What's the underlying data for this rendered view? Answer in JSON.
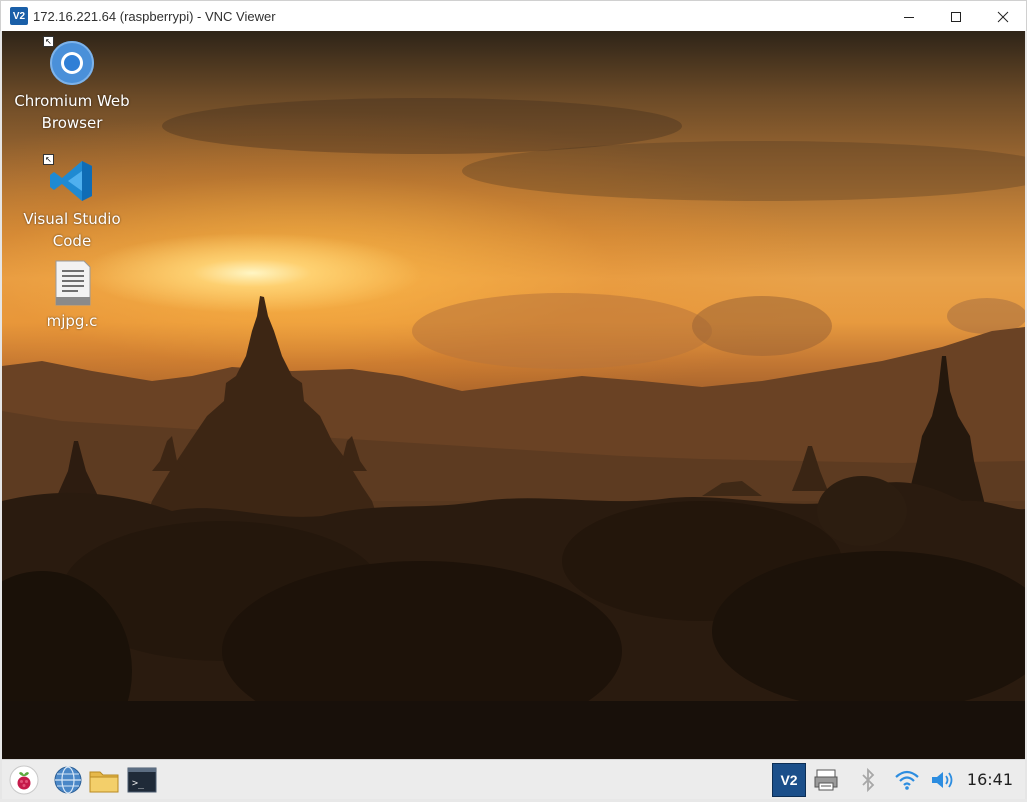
{
  "window": {
    "title": "172.16.221.64 (raspberrypi) - VNC Viewer",
    "app_icon_text": "V2"
  },
  "desktop": {
    "icons": [
      {
        "label_line1": "Chromium Web",
        "label_line2": "Browser",
        "icon": "chromium-icon",
        "shortcut": true
      },
      {
        "label_line1": "Visual Studio",
        "label_line2": "Code",
        "icon": "vscode-icon",
        "shortcut": true
      },
      {
        "label_line1": "mjpg.c",
        "label_line2": "",
        "icon": "text-file-icon",
        "shortcut": false
      }
    ]
  },
  "taskbar": {
    "launchers": [
      "raspberry-menu-icon",
      "web-browser-icon",
      "file-manager-icon",
      "terminal-icon"
    ],
    "tray": [
      "vnc-server-icon",
      "printer-icon",
      "bluetooth-icon",
      "wifi-icon",
      "volume-icon"
    ],
    "vnc_tray_text": "V2",
    "clock": "16:41"
  },
  "colors": {
    "accent": "#1b4f8a",
    "taskbar_bg": "#ececec",
    "sky_glow": "#ffd678"
  }
}
